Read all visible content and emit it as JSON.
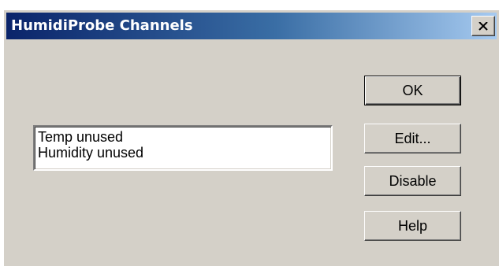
{
  "window": {
    "title": "HumidiProbe Channels"
  },
  "channels": {
    "items": [
      {
        "label": "Temp unused"
      },
      {
        "label": "Humidity unused"
      }
    ]
  },
  "buttons": {
    "ok": "OK",
    "edit": "Edit...",
    "disable": "Disable",
    "help": "Help"
  },
  "icons": {
    "close": "close-icon"
  },
  "colors": {
    "titlebar_start": "#0a246a",
    "titlebar_end": "#a6caf0",
    "dialog_face": "#d4d0c8"
  }
}
